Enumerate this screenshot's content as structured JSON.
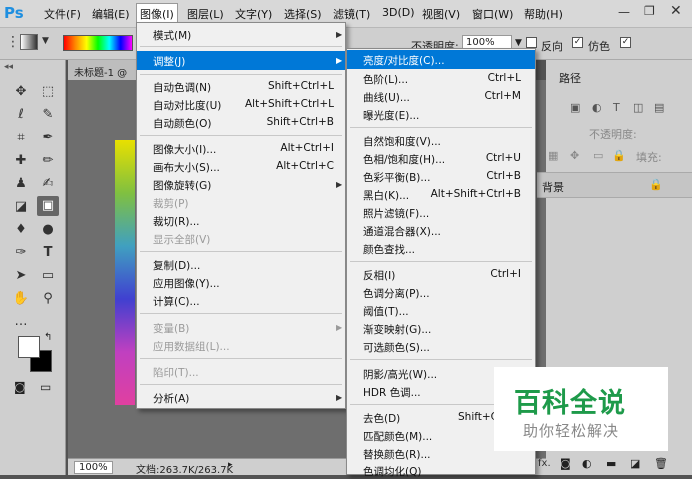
{
  "app": {
    "logo": "Ps"
  },
  "menubar": {
    "items": [
      "文件(F)",
      "编辑(E)",
      "图像(I)",
      "图层(L)",
      "文字(Y)",
      "选择(S)",
      "滤镜(T)",
      "3D(D)",
      "视图(V)",
      "窗口(W)",
      "帮助(H)"
    ],
    "active": "图像(I)"
  },
  "options": {
    "opacity_label": "不透明度:",
    "opacity_value": "100%",
    "reverse_label": "反向",
    "dither_label": "仿色"
  },
  "document": {
    "tab_title": "未标题-1 @"
  },
  "status": {
    "zoom": "100%",
    "doc_info": "文档:263.7K/263.7K"
  },
  "right_panel": {
    "tab_paths": "路径",
    "opacity_label": "不透明度:",
    "fill_label": "填充:",
    "layer_name": "背景"
  },
  "image_menu": {
    "items": [
      {
        "label": "模式(M)",
        "submenu": true
      },
      {
        "label": "调整(J)",
        "submenu": true,
        "highlighted": true
      },
      {
        "label": "自动色调(N)",
        "shortcut": "Shift+Ctrl+L"
      },
      {
        "label": "自动对比度(U)",
        "shortcut": "Alt+Shift+Ctrl+L"
      },
      {
        "label": "自动颜色(O)",
        "shortcut": "Shift+Ctrl+B"
      },
      {
        "label": "图像大小(I)...",
        "shortcut": "Alt+Ctrl+I"
      },
      {
        "label": "画布大小(S)...",
        "shortcut": "Alt+Ctrl+C"
      },
      {
        "label": "图像旋转(G)",
        "submenu": true
      },
      {
        "label": "裁剪(P)",
        "disabled": true
      },
      {
        "label": "裁切(R)..."
      },
      {
        "label": "显示全部(V)",
        "disabled": true
      },
      {
        "label": "复制(D)..."
      },
      {
        "label": "应用图像(Y)..."
      },
      {
        "label": "计算(C)..."
      },
      {
        "label": "变量(B)",
        "submenu": true,
        "disabled": true
      },
      {
        "label": "应用数据组(L)...",
        "disabled": true
      },
      {
        "label": "陷印(T)...",
        "disabled": true
      },
      {
        "label": "分析(A)",
        "submenu": true
      }
    ]
  },
  "adjust_menu": {
    "items": [
      {
        "label": "亮度/对比度(C)...",
        "highlighted": true
      },
      {
        "label": "色阶(L)...",
        "shortcut": "Ctrl+L"
      },
      {
        "label": "曲线(U)...",
        "shortcut": "Ctrl+M"
      },
      {
        "label": "曝光度(E)..."
      },
      {
        "label": "自然饱和度(V)..."
      },
      {
        "label": "色相/饱和度(H)...",
        "shortcut": "Ctrl+U"
      },
      {
        "label": "色彩平衡(B)...",
        "shortcut": "Ctrl+B"
      },
      {
        "label": "黑白(K)...",
        "shortcut": "Alt+Shift+Ctrl+B"
      },
      {
        "label": "照片滤镜(F)..."
      },
      {
        "label": "通道混合器(X)..."
      },
      {
        "label": "颜色查找..."
      },
      {
        "label": "反相(I)",
        "shortcut": "Ctrl+I"
      },
      {
        "label": "色调分离(P)..."
      },
      {
        "label": "阈值(T)..."
      },
      {
        "label": "渐变映射(G)..."
      },
      {
        "label": "可选颜色(S)..."
      },
      {
        "label": "阴影/高光(W)..."
      },
      {
        "label": "HDR 色调..."
      },
      {
        "label": "去色(D)",
        "shortcut": "Shift+C"
      },
      {
        "label": "匹配颜色(M)..."
      },
      {
        "label": "替换颜色(R)..."
      },
      {
        "label": "色调均化(Q)"
      }
    ]
  },
  "watermark": {
    "title": "百科全说",
    "subtitle": "助你轻松解决"
  }
}
